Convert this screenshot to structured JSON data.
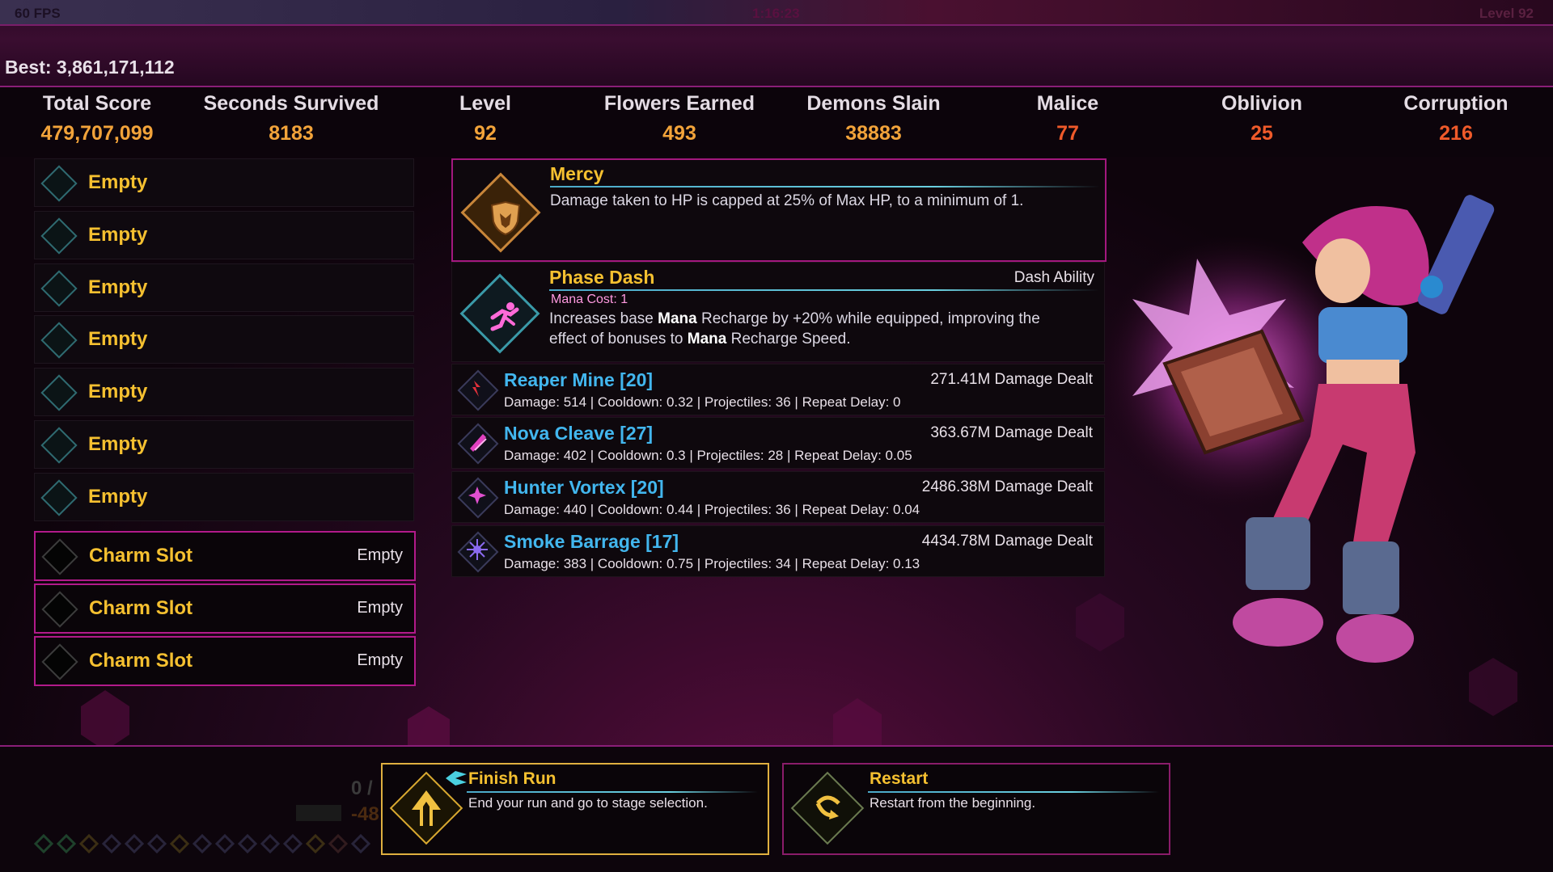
{
  "hud": {
    "fps": "60 FPS",
    "timer": "1:16:23",
    "level_corner": "Level 92",
    "best": "Best: 3,861,171,112"
  },
  "stats": [
    {
      "label": "Total Score",
      "value": "479,707,099"
    },
    {
      "label": "Seconds Survived",
      "value": "8183"
    },
    {
      "label": "Level",
      "value": "92"
    },
    {
      "label": "Flowers Earned",
      "value": "493"
    },
    {
      "label": "Demons Slain",
      "value": "38883"
    },
    {
      "label": "Malice",
      "value": "77"
    },
    {
      "label": "Oblivion",
      "value": "25"
    },
    {
      "label": "Corruption",
      "value": "216"
    }
  ],
  "slots": [
    {
      "name": "Empty"
    },
    {
      "name": "Empty"
    },
    {
      "name": "Empty"
    },
    {
      "name": "Empty"
    },
    {
      "name": "Empty"
    },
    {
      "name": "Empty"
    },
    {
      "name": "Empty"
    }
  ],
  "charms": [
    {
      "name": "Charm Slot",
      "status": "Empty"
    },
    {
      "name": "Charm Slot",
      "status": "Empty"
    },
    {
      "name": "Charm Slot",
      "status": "Empty"
    }
  ],
  "mercy": {
    "title": "Mercy",
    "desc": "Damage taken to HP is capped at 25% of Max HP, to a minimum of 1."
  },
  "dash": {
    "title": "Phase Dash",
    "tag": "Dash Ability",
    "mana": "Mana Cost: 1",
    "desc_a": "Increases base ",
    "desc_b": "Mana",
    "desc_c": " Recharge by +20% while equipped, improving the",
    "desc_d": "effect of bonuses to ",
    "desc_e": "Mana",
    "desc_f": " Recharge Speed."
  },
  "weapons": [
    {
      "name": "Reaper Mine [20]",
      "damage_dealt": "271.41M Damage Dealt",
      "stats": "Damage: 514 | Cooldown: 0.32 | Projectiles: 36 | Repeat Delay: 0",
      "icon": "reaper-mine-icon",
      "color": "#e0303a"
    },
    {
      "name": "Nova Cleave [27]",
      "damage_dealt": "363.67M Damage Dealt",
      "stats": "Damage: 402 | Cooldown: 0.3 | Projectiles: 28 | Repeat Delay: 0.05",
      "icon": "nova-cleave-icon",
      "color": "#e040c0"
    },
    {
      "name": "Hunter Vortex [20]",
      "damage_dealt": "2486.38M Damage Dealt",
      "stats": "Damage: 440 | Cooldown: 0.44 | Projectiles: 36 | Repeat Delay: 0.04",
      "icon": "hunter-vortex-icon",
      "color": "#e050d0"
    },
    {
      "name": "Smoke Barrage [17]",
      "damage_dealt": "4434.78M Damage Dealt",
      "stats": "Damage: 383 | Cooldown: 0.75 | Projectiles: 34 | Repeat Delay: 0.13",
      "icon": "smoke-barrage-icon",
      "color": "#8a6af0"
    }
  ],
  "actions": {
    "finish": {
      "title": "Finish Run",
      "desc": "End your run and go to stage selection."
    },
    "restart": {
      "title": "Restart",
      "desc": "Restart from the beginning."
    }
  },
  "background_hud": {
    "value_a": "0 /",
    "value_b": "-48"
  },
  "colors": {
    "accent_gold": "#f5c030",
    "stat_orange": "#f2a33a",
    "stat_red": "#ef5a2a",
    "weapon_blue": "#42b6ee",
    "border_magenta": "#a3187e"
  }
}
